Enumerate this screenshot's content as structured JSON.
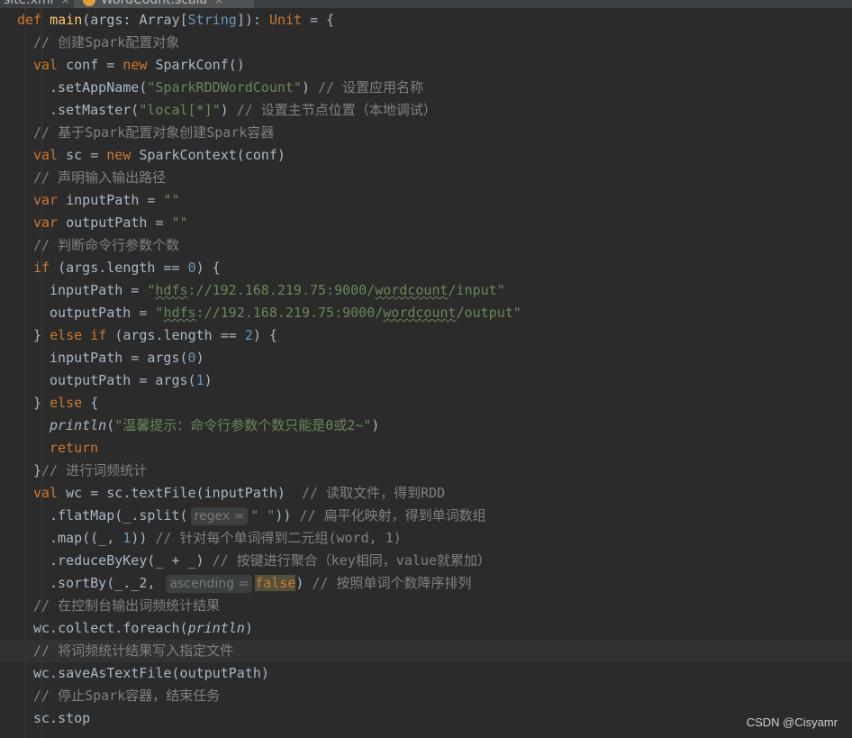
{
  "tabs": {
    "prev_tab": "site.xml",
    "prev_close": "×",
    "active_tab": "WordCount.scala",
    "active_close": "×"
  },
  "code": {
    "l1": [
      "def ",
      "main",
      "(args: Array[",
      "String",
      "]): ",
      "Unit",
      " = {"
    ],
    "l2": "// 创建Spark配置对象",
    "l3": [
      "val ",
      "conf = ",
      "new ",
      "SparkConf()"
    ],
    "l4": [
      ".setAppName(",
      "\"SparkRDDWordCount\"",
      ") ",
      "// 设置应用名称"
    ],
    "l5": [
      ".setMaster(",
      "\"local[*]\"",
      ") ",
      "// 设置主节点位置（本地调试）"
    ],
    "l6": "// 基于Spark配置对象创建Spark容器",
    "l7": [
      "val ",
      "sc = ",
      "new ",
      "SparkContext(conf)"
    ],
    "l8": "// 声明输入输出路径",
    "l9": [
      "var ",
      "inputPath = ",
      "\"\""
    ],
    "l10": [
      "var ",
      "outputPath = ",
      "\"\""
    ],
    "l11": "// 判断命令行参数个数",
    "l12": [
      "if ",
      "(args.length == ",
      "0",
      ") {"
    ],
    "l13": [
      "inputPath = ",
      "\"",
      "hdfs",
      "://192.168.219.75:9000/",
      "wordcount",
      "/input\""
    ],
    "l14": [
      "outputPath = ",
      "\"",
      "hdfs",
      "://192.168.219.75:9000/",
      "wordcount",
      "/output\""
    ],
    "l15": [
      "} ",
      "else if ",
      "(args.length == ",
      "2",
      ") {"
    ],
    "l16": [
      "inputPath = args(",
      "0",
      ")"
    ],
    "l17": [
      "outputPath = args(",
      "1",
      ")"
    ],
    "l18": [
      "} ",
      "else ",
      "{"
    ],
    "l19": [
      "println",
      "(",
      "\"温馨提示：命令行参数个数只能是0或2~\"",
      ")"
    ],
    "l20": "return",
    "l21": [
      "}",
      "// 进行词频统计"
    ],
    "l22": [
      "val ",
      "wc = sc.textFile(inputPath)  ",
      "// 读取文件，得到RDD"
    ],
    "l23": [
      ".flatMap(_.split(",
      "regex =",
      "\" \"",
      ")) ",
      "// 扁平化映射，得到单词数组"
    ],
    "l24": [
      ".map((_, ",
      "1",
      ")) ",
      "// 针对每个单词得到二元组(word, 1)"
    ],
    "l25": [
      ".reduceByKey(_ + _) ",
      "// 按键进行聚合（key相同，value就累加）"
    ],
    "l26": [
      ".sortBy(_._2, ",
      "ascending =",
      "false",
      ") ",
      "// 按照单词个数降序排列"
    ],
    "l27": "// 在控制台输出词频统计结果",
    "l28": [
      "wc.collect.foreach(",
      "println",
      ")"
    ],
    "l29": "// 将词频统计结果写入指定文件",
    "l30": "wc.saveAsTextFile(outputPath)",
    "l31": "// 停止Spark容器，结束任务",
    "l32": "sc.stop"
  },
  "watermark": "CSDN @Cisyamr"
}
